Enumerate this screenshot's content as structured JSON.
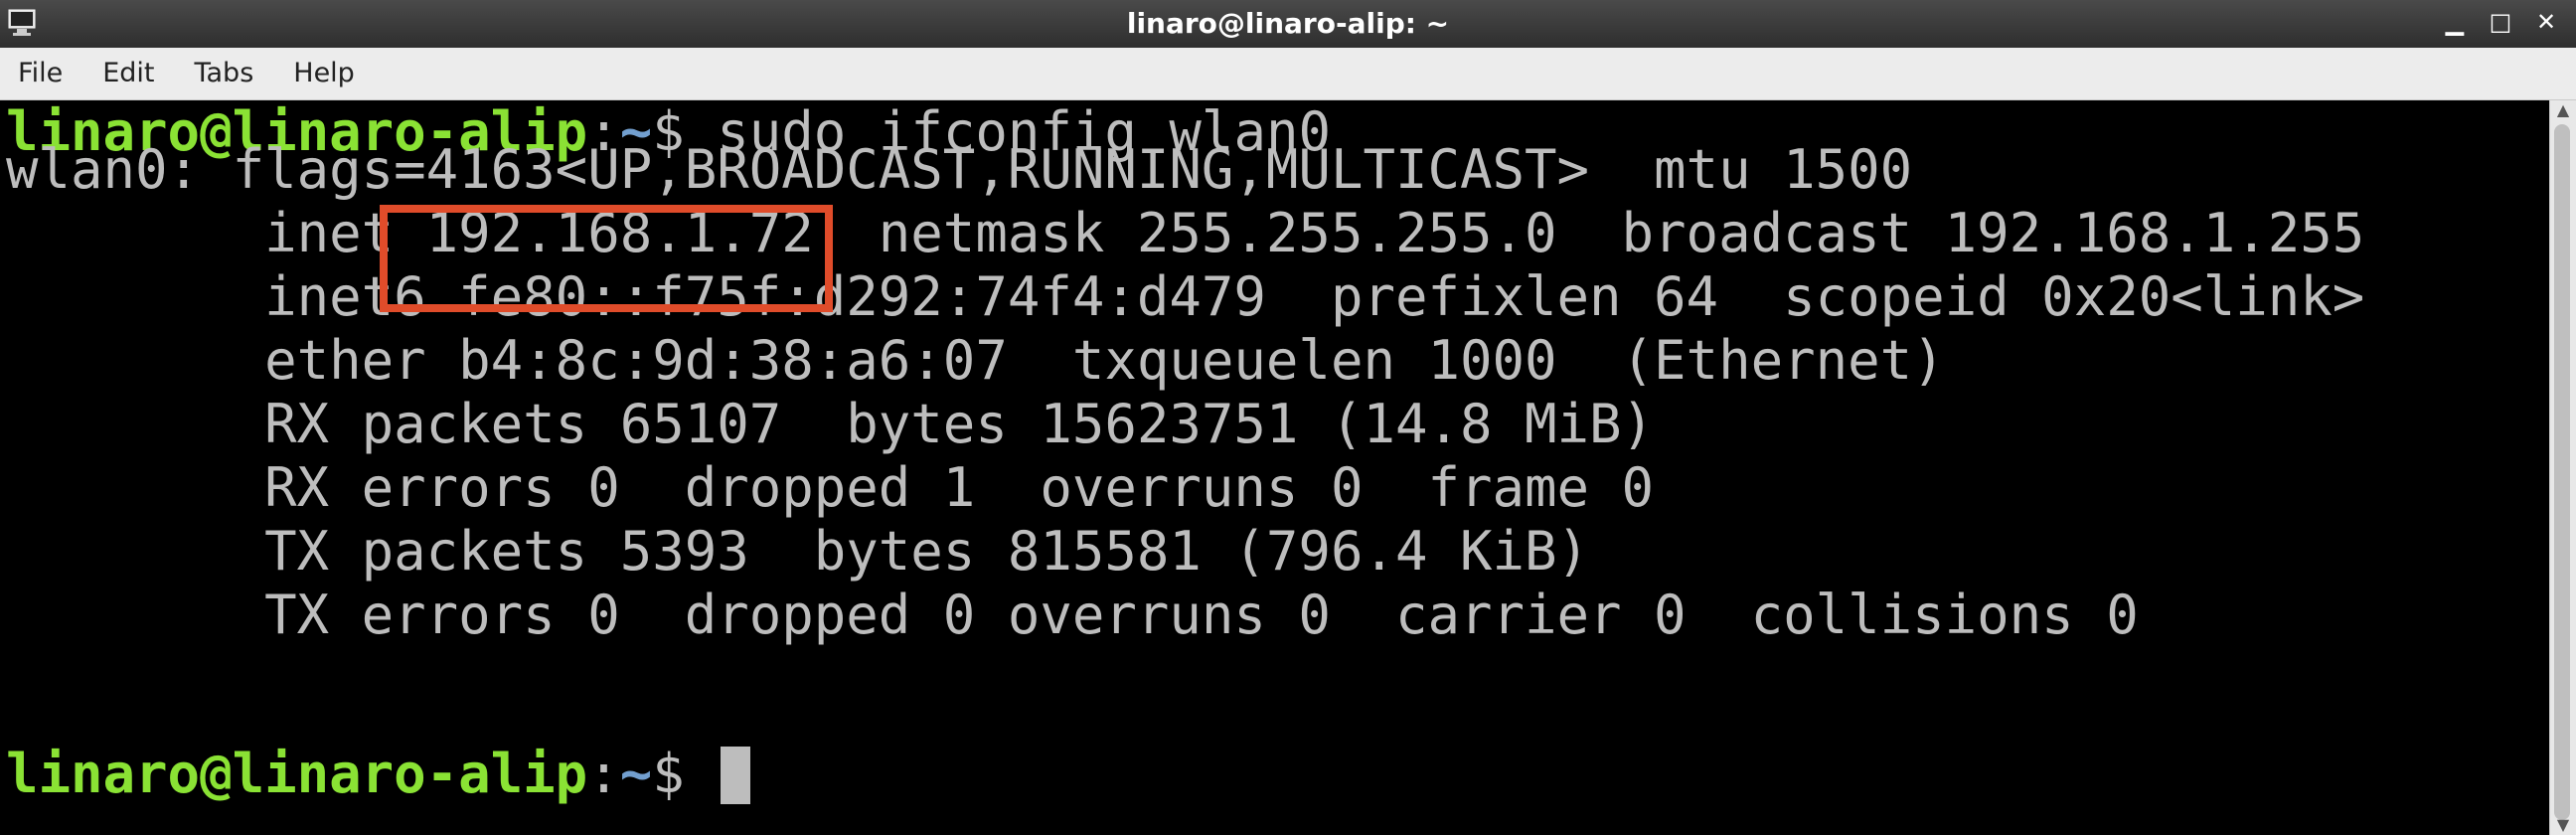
{
  "window": {
    "title": "linaro@linaro-alip: ~"
  },
  "title_controls": {
    "minimize_glyph": "▁",
    "maximize_glyph": "□",
    "close_glyph": "✕"
  },
  "menu": {
    "items": [
      "File",
      "Edit",
      "Tabs",
      "Help"
    ]
  },
  "colors": {
    "prompt_user": "#8ae234",
    "prompt_path": "#729fcf",
    "terminal_text": "#bdbdbd",
    "terminal_bg": "#000000",
    "highlight_box": "#e04c2a"
  },
  "terminal": {
    "prompt": {
      "user_host": "linaro@linaro-alip",
      "colon": ":",
      "path": "~",
      "dollar": "$ "
    },
    "command": "sudo ifconfig wlan0",
    "output_lines": [
      "wlan0: flags=4163<UP,BROADCAST,RUNNING,MULTICAST>  mtu 1500",
      "        inet 192.168.1.72  netmask 255.255.255.0  broadcast 192.168.1.255",
      "        inet6 fe80::f75f:d292:74f4:d479  prefixlen 64  scopeid 0x20<link>",
      "        ether b4:8c:9d:38:a6:07  txqueuelen 1000  (Ethernet)",
      "        RX packets 65107  bytes 15623751 (14.8 MiB)",
      "        RX errors 0  dropped 1  overruns 0  frame 0",
      "        TX packets 5393  bytes 815581 (796.4 KiB)",
      "        TX errors 0  dropped 0 overruns 0  carrier 0  collisions 0"
    ],
    "highlighted_value": "192.168.1.72"
  },
  "scrollbar": {
    "up_arrow": "▲",
    "down_arrow": "▼"
  },
  "icons": {
    "app_icon": "terminal-icon"
  }
}
